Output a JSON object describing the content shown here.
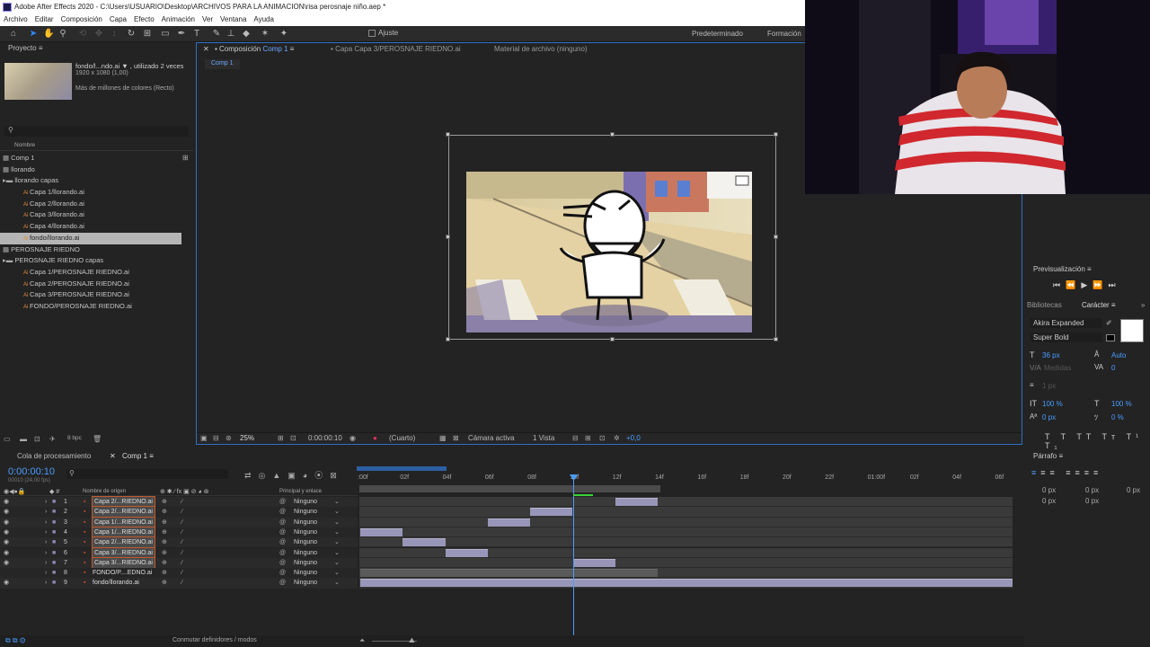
{
  "window": {
    "title": "Adobe After Effects 2020 - C:\\Users\\USUARIO\\Desktop\\ARCHIVOS PARA LA ANIMACION\\risa perosnaje niño.aep *"
  },
  "menu": [
    "Archivo",
    "Editar",
    "Composición",
    "Capa",
    "Efecto",
    "Animación",
    "Ver",
    "Ventana",
    "Ayuda"
  ],
  "toolbar": {
    "snap_label": "Ajuste",
    "workspace_default": "Predeterminado",
    "workspace_training": "Formación"
  },
  "project": {
    "panel_title": "Proyecto",
    "selected_name": "fondo/l...ndo.ai ▼ , utilizado 2 veces",
    "selected_dims": "1920 x 1080 (1,00)",
    "selected_colors": "Más de millones de colores (Recto)",
    "search_placeholder": "",
    "column_name": "Nombre",
    "bpc": "8 bpc",
    "items": [
      {
        "label": "Comp 1",
        "indent": 0,
        "type": "comp"
      },
      {
        "label": "llorando",
        "indent": 0,
        "type": "comp"
      },
      {
        "label": "llorando capas",
        "indent": 0,
        "type": "folder"
      },
      {
        "label": "Capa 1/llorando.ai",
        "indent": 1,
        "type": "ai"
      },
      {
        "label": "Capa 2/llorando.ai",
        "indent": 1,
        "type": "ai"
      },
      {
        "label": "Capa 3/llorando.ai",
        "indent": 1,
        "type": "ai"
      },
      {
        "label": "Capa 4/llorando.ai",
        "indent": 1,
        "type": "ai"
      },
      {
        "label": "fondo/llorando.ai",
        "indent": 1,
        "type": "ai",
        "selected": true
      },
      {
        "label": "PEROSNAJE RIEDNO",
        "indent": 0,
        "type": "comp"
      },
      {
        "label": "PEROSNAJE RIEDNO capas",
        "indent": 0,
        "type": "folder"
      },
      {
        "label": "Capa 1/PEROSNAJE RIEDNO.ai",
        "indent": 1,
        "type": "ai"
      },
      {
        "label": "Capa 2/PEROSNAJE RIEDNO.ai",
        "indent": 1,
        "type": "ai"
      },
      {
        "label": "Capa 3/PEROSNAJE RIEDNO.ai",
        "indent": 1,
        "type": "ai"
      },
      {
        "label": "FONDO/PEROSNAJE RIEDNO.ai",
        "indent": 1,
        "type": "ai"
      }
    ]
  },
  "composition": {
    "tab_label": "Composición",
    "tab_comp": "Comp 1",
    "layer_tab": "Capa  Capa 3/PEROSNAJE RIEDNO.ai",
    "footage_tab": "Material de archivo  (ninguno)",
    "breadcrumb": "Comp 1",
    "zoom": "25%",
    "timecode": "0:00:00:10",
    "resolution": "(Cuarto)",
    "camera": "Cámara activa",
    "views": "1 Vista",
    "exposure": "+0,0"
  },
  "preview": {
    "title": "Previsualización"
  },
  "character": {
    "tab_libraries": "Bibliotecas",
    "tab_character": "Carácter",
    "font": "Akira Expanded",
    "style": "Super Bold",
    "size": "36 px",
    "leading": "Auto",
    "kerning": "Medidas",
    "tracking": "0",
    "stroke": "1 px",
    "vscale": "100 %",
    "hscale": "100 %",
    "baseline": "0 px",
    "tsume": "0 %"
  },
  "paragraph": {
    "title": "Párrafo",
    "indent_a": "0 px",
    "indent_b": "0 px",
    "indent_c": "0 px",
    "space_a": "0 px",
    "space_b": "0 px"
  },
  "timeline": {
    "tab_render": "Cola de procesamiento",
    "tab_comp": "Comp 1",
    "timecode": "0:00:00:10",
    "fps": "00010 (24,00 fps)",
    "col_source": "Nombre de origen",
    "col_parent": "Principal y enlace",
    "footer_toggle": "Conmutar definidores / modos",
    "ruler": [
      ":00f",
      "02f",
      "04f",
      "06f",
      "08f",
      "10f",
      "12f",
      "14f",
      "16f",
      "18f",
      "20f",
      "22f",
      "01:00f",
      "02f",
      "04f",
      "06f"
    ],
    "layers": [
      {
        "num": "1",
        "name": "Capa 2/...RIEDNO.ai",
        "parent": "Ninguno",
        "start": 12,
        "end": 14
      },
      {
        "num": "2",
        "name": "Capa 2/...RIEDNO.ai",
        "parent": "Ninguno",
        "start": 8,
        "end": 10
      },
      {
        "num": "3",
        "name": "Capa 1/...RIEDNO.ai",
        "parent": "Ninguno",
        "start": 6,
        "end": 8
      },
      {
        "num": "4",
        "name": "Capa 1/...RIEDNO.ai",
        "parent": "Ninguno",
        "start": 0,
        "end": 2
      },
      {
        "num": "5",
        "name": "Capa 2/...RIEDNO.ai",
        "parent": "Ninguno",
        "start": 2,
        "end": 4
      },
      {
        "num": "6",
        "name": "Capa 3/...RIEDNO.ai",
        "parent": "Ninguno",
        "start": 4,
        "end": 6
      },
      {
        "num": "7",
        "name": "Capa 3/...RIEDNO.ai",
        "parent": "Ninguno",
        "start": 10,
        "end": 12
      },
      {
        "num": "8",
        "name": "FONDO/P....EDNO.ai",
        "parent": "Ninguno",
        "start": 0,
        "end": 14
      },
      {
        "num": "9",
        "name": "fondo/llorando.ai",
        "parent": "Ninguno",
        "start": 0,
        "end": 31
      }
    ]
  }
}
